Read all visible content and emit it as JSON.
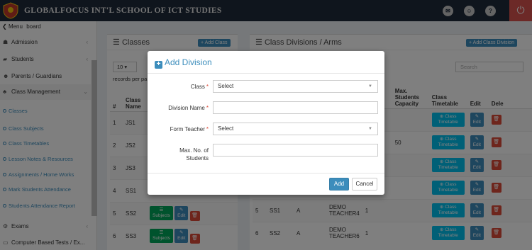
{
  "topbar": {
    "title": "GLOBALFOCUS INT'L SCHOOL OF ICT STUDIES",
    "icon_mail": "✉",
    "icon_user": "☺",
    "icon_help": "?",
    "icon_power": "⏻"
  },
  "sidebar": {
    "menu_toggle": "Menu",
    "menu_suffix": "board",
    "items": [
      {
        "label": "Admission",
        "icon": "user-plus-icon"
      },
      {
        "label": "Students",
        "icon": "graduation-cap-icon"
      },
      {
        "label": "Parents / Guardians",
        "icon": "users-icon"
      },
      {
        "label": "Class Management",
        "icon": "sitemap-icon"
      }
    ],
    "subitems": [
      "Classes",
      "Class Subjects",
      "Class Timetables",
      "Lesson Notes & Resources",
      "Assignments / Home Works",
      "Mark Students Attendance",
      "Students Attendance Report"
    ],
    "bottom_items": [
      {
        "label": "Exams",
        "icon": "gear-icon"
      },
      {
        "label": "Computer Based Tests / Ex..."
      }
    ]
  },
  "classes_panel": {
    "title": "Classes",
    "add_button": "Add Class",
    "page_size": "10",
    "records_label": "records per pa",
    "headers": [
      "#",
      "Class Name"
    ],
    "rows": [
      {
        "n": "1",
        "name": "JS1"
      },
      {
        "n": "2",
        "name": "JS2"
      },
      {
        "n": "3",
        "name": "JS3"
      },
      {
        "n": "4",
        "name": "SS1"
      },
      {
        "n": "5",
        "name": "SS2"
      },
      {
        "n": "6",
        "name": "SS3"
      }
    ],
    "subjects_label": "Subjects",
    "edit_label": "Edit"
  },
  "divisions_panel": {
    "title": "Class Divisions / Arms",
    "add_button": "Add Class Division",
    "search_placeholder": "Search",
    "headers": [
      "ents",
      "Max. Students Capacity",
      "Class Timetable",
      "Edit",
      "Dele"
    ],
    "rows": [
      {
        "n": "",
        "class": "",
        "arm": "",
        "teacher": "",
        "students": "",
        "capacity": ""
      },
      {
        "n": "",
        "class": "",
        "arm": "",
        "teacher": "",
        "students": "",
        "capacity": "50"
      },
      {
        "n": "",
        "class": "",
        "arm": "",
        "teacher": "",
        "students": "",
        "capacity": ""
      },
      {
        "n": "",
        "class": "",
        "arm": "",
        "teacher": "",
        "students": "",
        "capacity": ""
      },
      {
        "n": "5",
        "class": "SS1",
        "arm": "A",
        "teacher": "DEMO TEACHER4",
        "students": "1",
        "capacity": ""
      },
      {
        "n": "6",
        "class": "SS2",
        "arm": "A",
        "teacher": "DEMO TEACHER6",
        "students": "1",
        "capacity": ""
      }
    ],
    "timetable_label": "Class Timetable",
    "edit_label": "Edit"
  },
  "modal": {
    "title": "Add Division",
    "fields": {
      "class_label": "Class",
      "class_value": "Select",
      "division_label": "Division Name",
      "division_value": "",
      "teacher_label": "Form Teacher",
      "teacher_value": "Select",
      "max_label_line1": "Max. No. of",
      "max_label_line2": "Students",
      "max_value": ""
    },
    "required_mark": "*",
    "add_button": "Add",
    "cancel_button": "Cancel"
  },
  "colors": {
    "topbar": "#1e2a3a",
    "accent": "#3c8dbc",
    "danger": "#dd4b39",
    "success": "#00a65a"
  }
}
